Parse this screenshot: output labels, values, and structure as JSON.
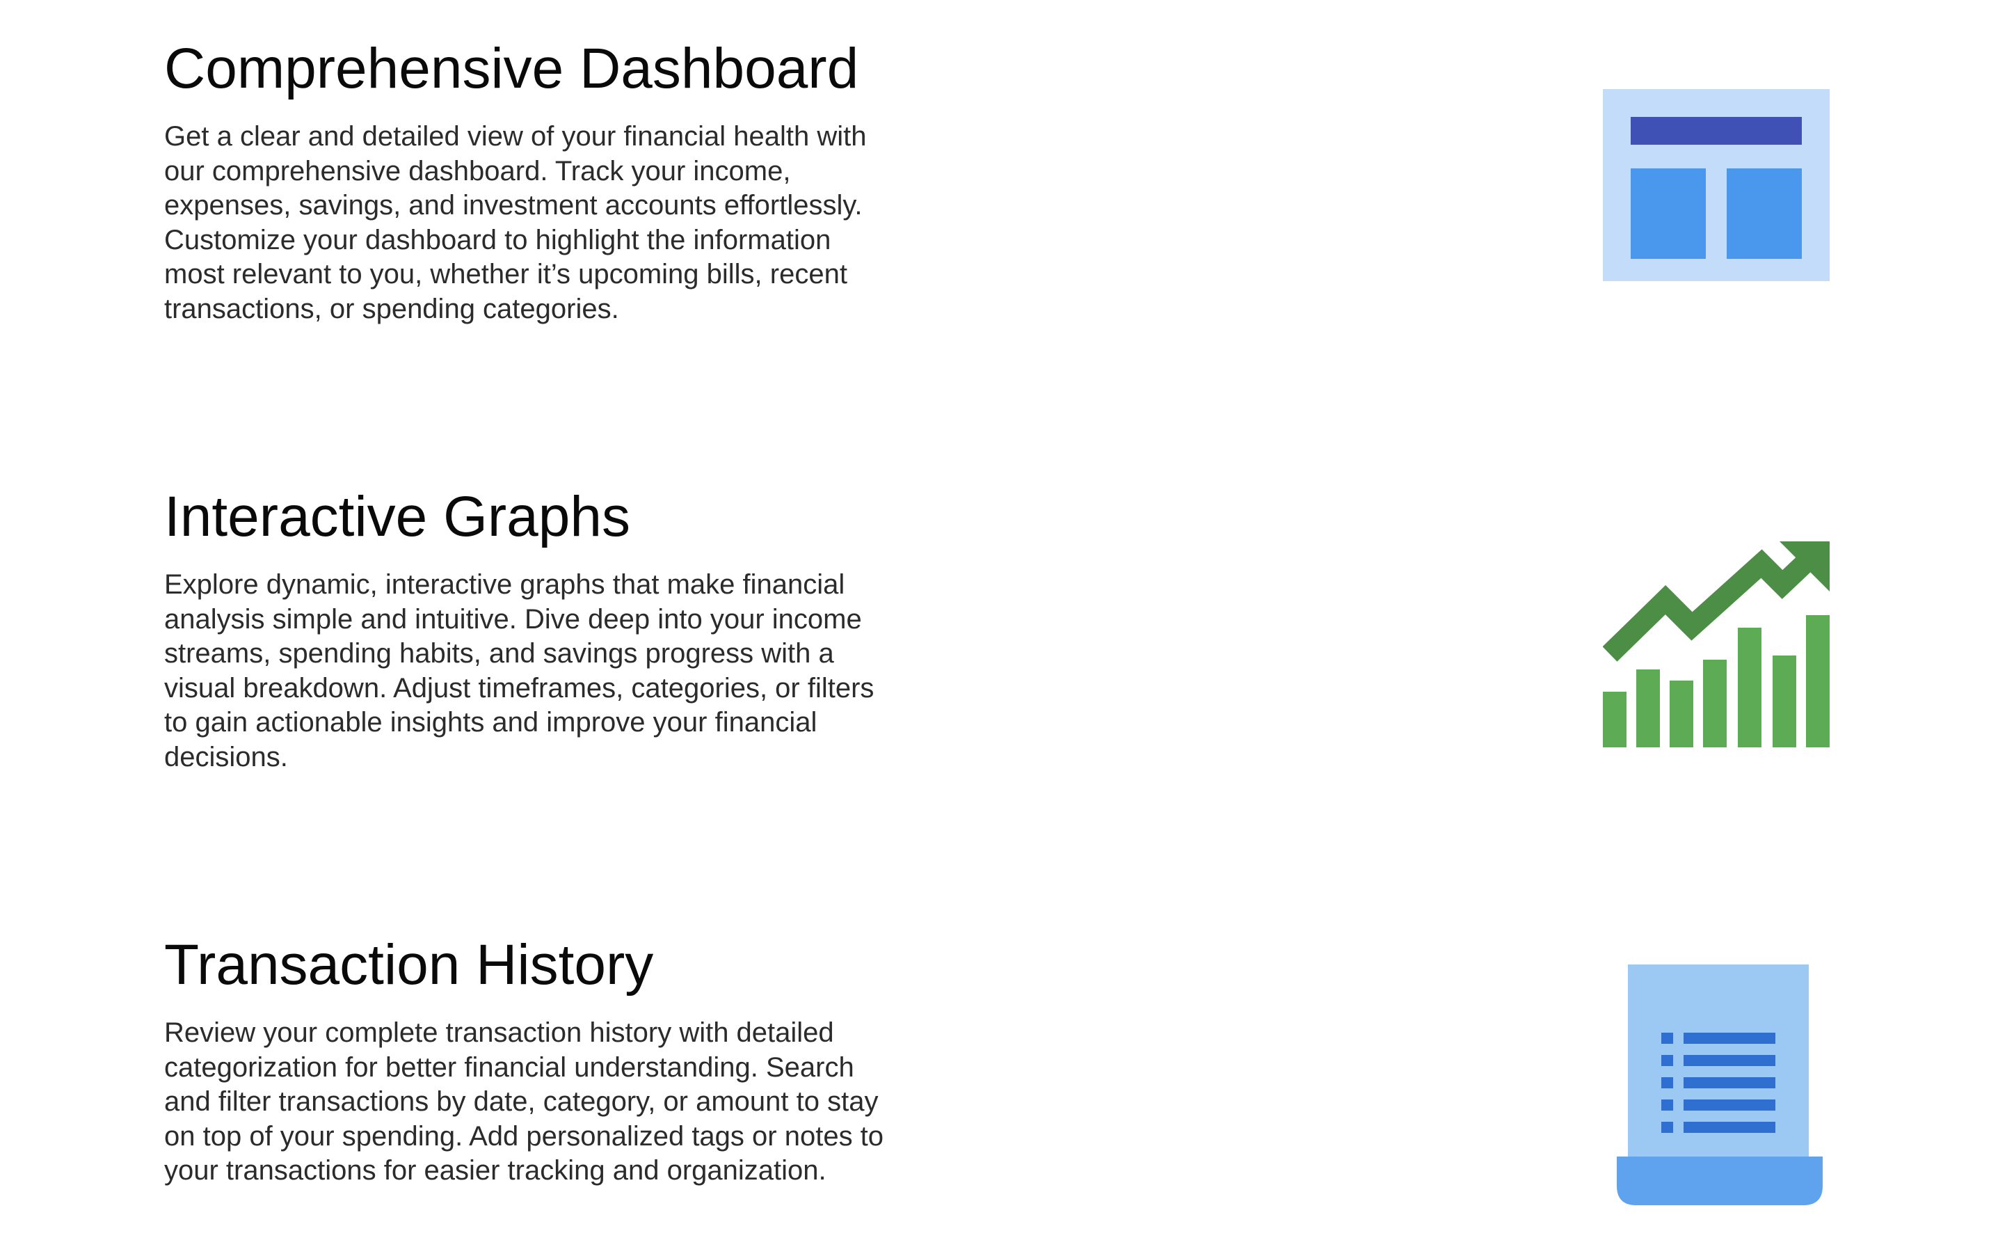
{
  "features": [
    {
      "title": "Comprehensive Dashboard",
      "description": "Get a clear and detailed view of your financial health with our comprehensive dashboard. Track your income, expenses, savings, and investment accounts effortlessly. Customize your dashboard to highlight the information most relevant to you, whether it’s upcoming bills, recent transactions, or spending categories.",
      "icon": "dashboard-icon",
      "colors": {
        "background": "#c2dcf9",
        "header": "#3f51b5",
        "panel": "#4a97ee"
      }
    },
    {
      "title": "Interactive Graphs",
      "description": "Explore dynamic, interactive graphs that make financial analysis simple and intuitive. Dive deep into your income streams, spending habits, and savings progress with a visual breakdown. Adjust timeframes, categories, or filters to gain actionable insights and improve your financial decisions.",
      "icon": "trending-chart-icon",
      "colors": {
        "arrow": "#4c8e45",
        "bars": "#5eab56"
      }
    },
    {
      "title": "Transaction History",
      "description": "Review your complete transaction history with detailed categorization for better financial understanding. Search and filter transactions by date, category, or amount to stay on top of your spending. Add personalized tags or notes to your transactions for easier tracking and organization.",
      "icon": "receipt-list-icon",
      "colors": {
        "paper": "#9cc8f4",
        "base": "#5fa2ee",
        "lines": "#2f6fd0"
      }
    }
  ]
}
